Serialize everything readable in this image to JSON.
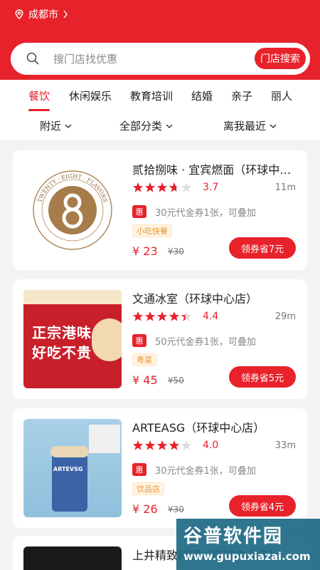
{
  "header": {
    "city": "成都市",
    "search_placeholder": "搜门店找优惠",
    "search_button": "门店搜索"
  },
  "tabs": [
    {
      "label": "餐饮",
      "active": true
    },
    {
      "label": "休闲娱乐",
      "active": false
    },
    {
      "label": "教育培训",
      "active": false
    },
    {
      "label": "结婚",
      "active": false
    },
    {
      "label": "亲子",
      "active": false
    },
    {
      "label": "丽人",
      "active": false
    }
  ],
  "filters": [
    {
      "label": "附近"
    },
    {
      "label": "全部分类"
    },
    {
      "label": "离我最近"
    }
  ],
  "stores": [
    {
      "name": "贰拾捌味 · 宜宾燃面（环球中心店）",
      "rating_value": 3.7,
      "rating": "3.7",
      "distance": "11m",
      "badge": "惠",
      "voucher": "30元代金券1张，可叠加",
      "tag": "小吃快餐",
      "price": "¥ 23",
      "old_price": "¥30",
      "coupon_button": "领券省7元",
      "logo_text": "TWENTY · EIGHT · FLAVORS"
    },
    {
      "name": "文通冰室（环球中心店）",
      "rating_value": 4.4,
      "rating": "4.4",
      "distance": "29m",
      "badge": "惠",
      "voucher": "50元代金券1张，可叠加",
      "tag": "粤菜",
      "price": "¥ 45",
      "old_price": "¥50",
      "coupon_button": "领券省5元",
      "poster_line1": "正宗港味",
      "poster_line2": "好吃不贵"
    },
    {
      "name": "ARTEASG（环球中心店）",
      "rating_value": 4.0,
      "rating": "4.0",
      "distance": "33m",
      "badge": "惠",
      "voucher": "30元代金券1张，可叠加",
      "tag": "饮品店",
      "price": "¥ 26",
      "old_price": "¥30",
      "coupon_button": "领券省4元",
      "cup_text": "ARTEVSG"
    },
    {
      "name": "上井精致料理（环球中心店）"
    }
  ],
  "watermark": {
    "title": "谷普软件园",
    "url": "www.gupuxiazai.com"
  },
  "colors": {
    "brand_red": "#e8222b",
    "star_empty": "#dddddd",
    "tag_orange": "#e6962d"
  }
}
